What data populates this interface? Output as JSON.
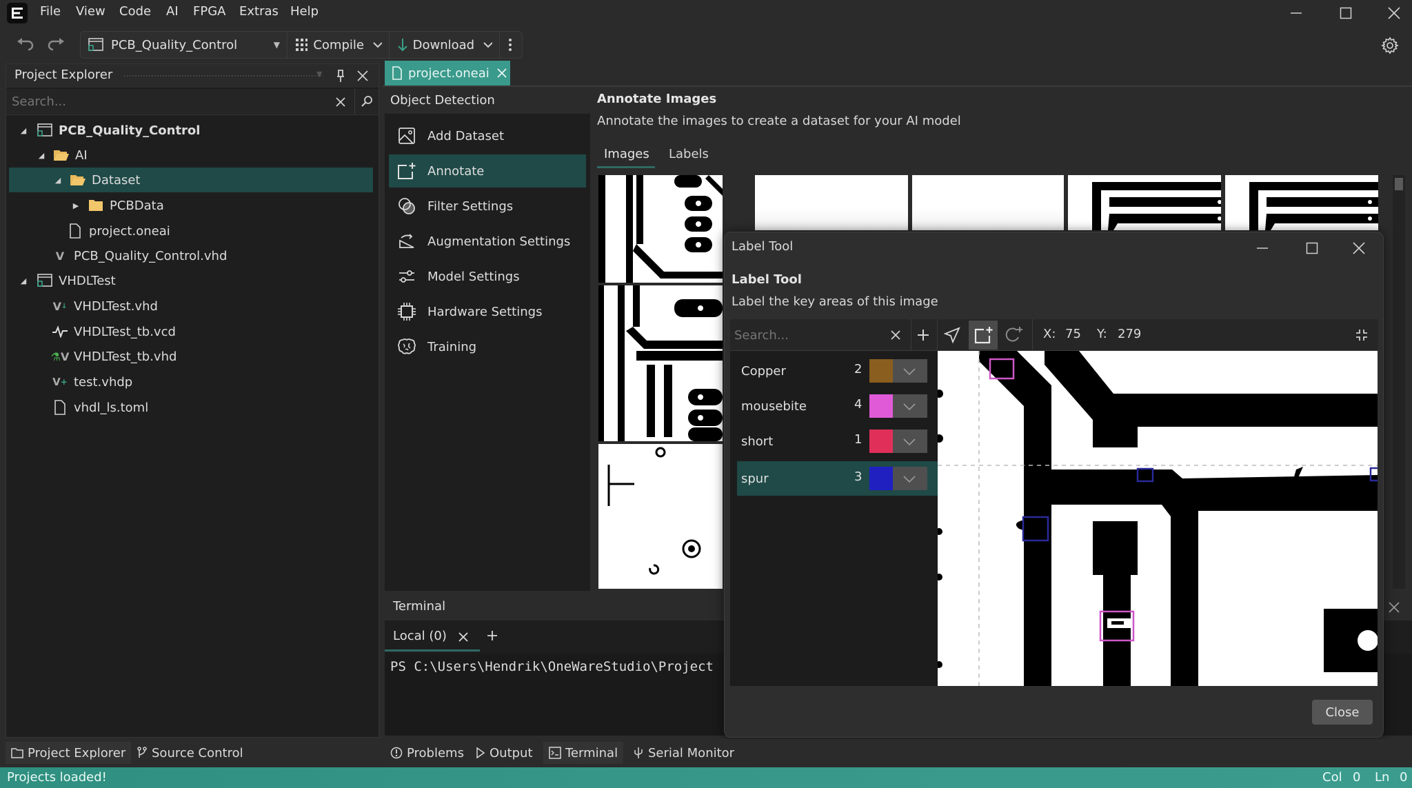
{
  "menu": {
    "items": [
      "File",
      "View",
      "Code",
      "AI",
      "FPGA",
      "Extras",
      "Help"
    ]
  },
  "toolbar": {
    "project_select": "PCB_Quality_Control",
    "compile_label": "Compile",
    "download_label": "Download"
  },
  "project_explorer": {
    "title": "Project Explorer",
    "search_placeholder": "Search...",
    "tree": [
      {
        "label": "PCB_Quality_Control",
        "level": 0,
        "icon": "project-icon",
        "expanded": true,
        "bold": true
      },
      {
        "label": "AI",
        "level": 1,
        "icon": "folder-open-icon",
        "expanded": true
      },
      {
        "label": "Dataset",
        "level": 2,
        "icon": "folder-open-icon",
        "expanded": true,
        "selected": true
      },
      {
        "label": "PCBData",
        "level": 3,
        "icon": "folder-icon",
        "expanded": false
      },
      {
        "label": "project.oneai",
        "level": 3,
        "icon": "file-icon"
      },
      {
        "label": "PCB_Quality_Control.vhd",
        "level": 2,
        "icon": "vhdl-file-icon"
      },
      {
        "label": "VHDLTest",
        "level": 0,
        "icon": "project-icon",
        "expanded": true
      },
      {
        "label": "VHDLTest.vhd",
        "level": 2,
        "icon": "vhdl-file-icon"
      },
      {
        "label": "VHDLTest_tb.vcd",
        "level": 2,
        "icon": "waveform-icon"
      },
      {
        "label": "VHDLTest_tb.vhd",
        "level": 2,
        "icon": "vhdl-testbench-icon"
      },
      {
        "label": "test.vhdp",
        "level": 2,
        "icon": "vhdp-file-icon"
      },
      {
        "label": "vhdl_ls.toml",
        "level": 2,
        "icon": "file-icon"
      }
    ]
  },
  "editor_tab": {
    "label": "project.oneai"
  },
  "object_detection": {
    "title": "Object Detection",
    "items": [
      {
        "label": "Add Dataset",
        "icon": "image-icon"
      },
      {
        "label": "Annotate",
        "icon": "annotate-icon",
        "active": true
      },
      {
        "label": "Filter Settings",
        "icon": "filter-icon"
      },
      {
        "label": "Augmentation Settings",
        "icon": "augmentation-icon"
      },
      {
        "label": "Model Settings",
        "icon": "sliders-icon"
      },
      {
        "label": "Hardware Settings",
        "icon": "chip-icon"
      },
      {
        "label": "Training",
        "icon": "brain-icon"
      }
    ]
  },
  "annotate": {
    "title": "Annotate Images",
    "subtitle": "Annotate the images to create a dataset for your AI model",
    "tabs": [
      "Images",
      "Labels"
    ],
    "active_tab": "Images"
  },
  "label_tool": {
    "window_title": "Label Tool",
    "heading": "Label Tool",
    "description": "Label the key areas of this image",
    "search_placeholder": "Search...",
    "coord_x_label": "X:",
    "coord_x": "75",
    "coord_y_label": "Y:",
    "coord_y": "279",
    "labels": [
      {
        "name": "Copper",
        "count": "2",
        "color": "#8a5e1f"
      },
      {
        "name": "mousebite",
        "count": "4",
        "color": "#e05ad8"
      },
      {
        "name": "short",
        "count": "1",
        "color": "#e0305a"
      },
      {
        "name": "spur",
        "count": "3",
        "color": "#2020c0",
        "selected": true
      }
    ],
    "close_label": "Close"
  },
  "terminal": {
    "title": "Terminal",
    "tab_label": "Local (0)",
    "prompt": "PS C:\\Users\\Hendrik\\OneWareStudio\\Project"
  },
  "bottom_tabs": {
    "left": [
      "Project Explorer",
      "Source Control"
    ],
    "right": [
      "Problems",
      "Output",
      "Terminal",
      "Serial Monitor"
    ]
  },
  "status": {
    "message": "Projects loaded!",
    "col_label": "Col",
    "col": "0",
    "ln_label": "Ln",
    "ln": "0"
  },
  "colors": {
    "accent": "#1f4a47",
    "tab_active": "#3a9a8c",
    "statusbar": "#3a9a8c"
  }
}
